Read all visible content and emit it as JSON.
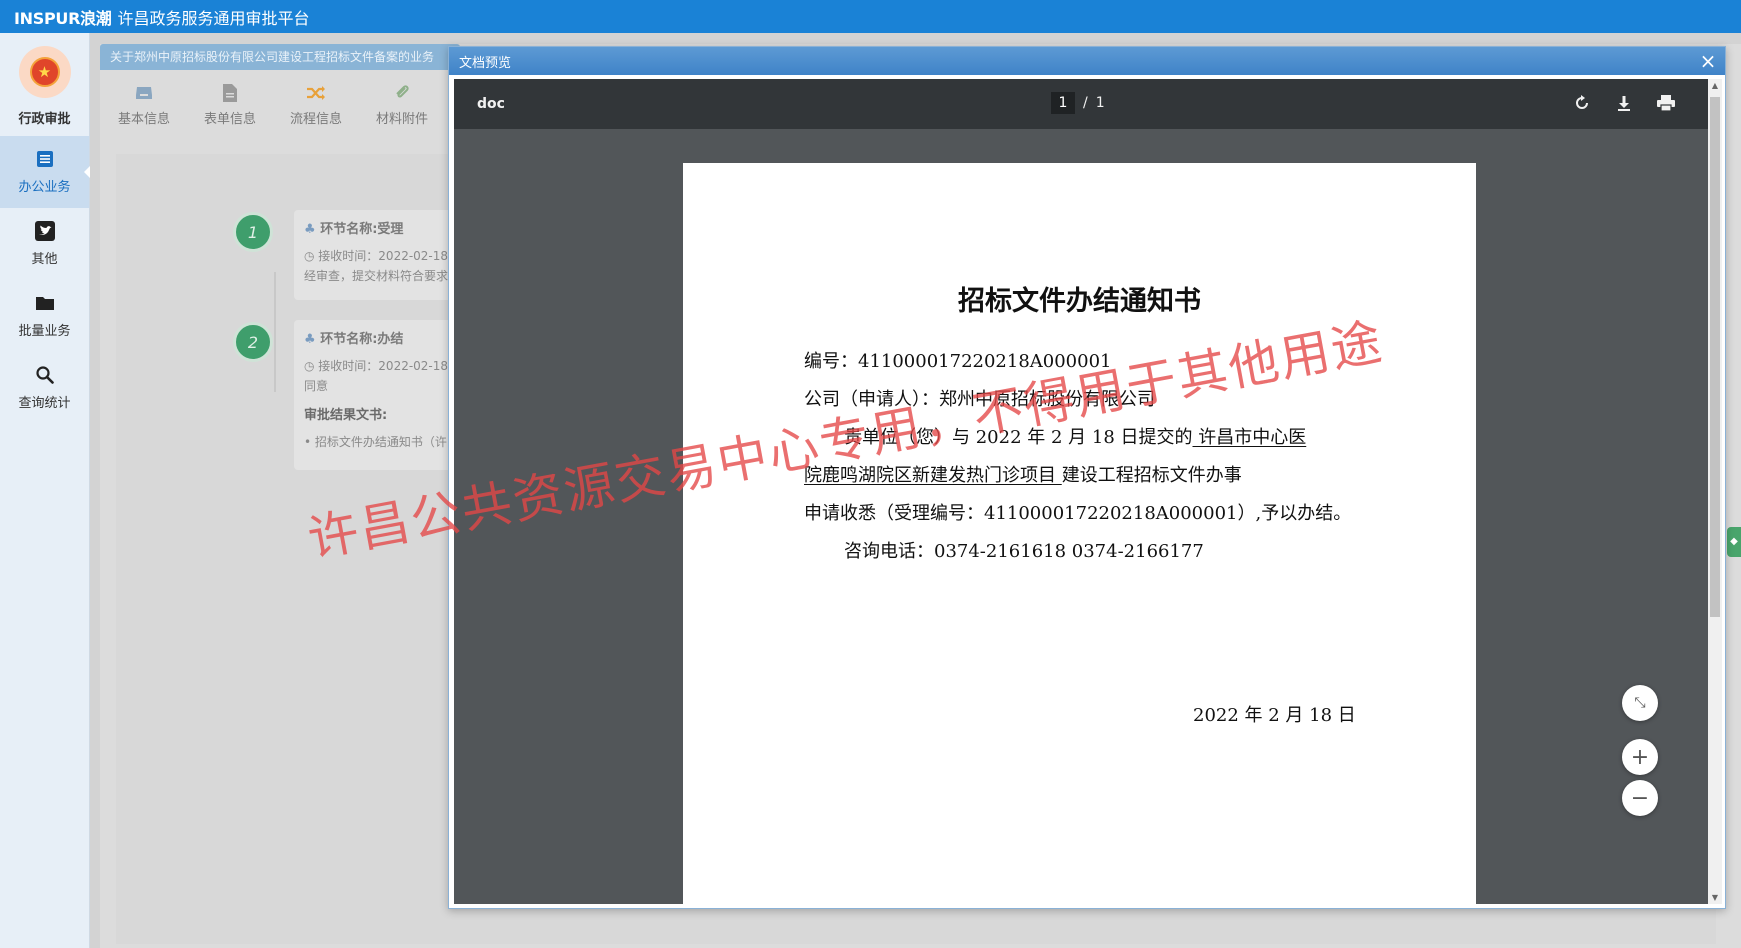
{
  "app": {
    "brand": "INSPUR浪潮",
    "title": "许昌政务服务通用审批平台"
  },
  "sidebar": {
    "logo_label": "行政审批",
    "items": [
      {
        "label": "办公业务",
        "icon": "list-icon",
        "active": true
      },
      {
        "label": "其他",
        "icon": "twitter-icon",
        "active": false
      },
      {
        "label": "批量业务",
        "icon": "folder-icon",
        "active": false
      },
      {
        "label": "查询统计",
        "icon": "search-icon",
        "active": false
      }
    ]
  },
  "workspace": {
    "tab_title": "关于郑州中原招标股份有限公司建设工程招标文件备案的业务",
    "toolbar": [
      {
        "label": "基本信息",
        "icon": "inbox-icon"
      },
      {
        "label": "表单信息",
        "icon": "document-icon"
      },
      {
        "label": "流程信息",
        "icon": "shuffle-icon"
      },
      {
        "label": "材料附件",
        "icon": "paperclip-icon"
      }
    ],
    "steps": [
      {
        "num": "1",
        "name": "环节名称:受理",
        "time": "接收时间：2022-02-18",
        "note": "经审查，提交材料符合要求"
      },
      {
        "num": "2",
        "name": "环节名称:办结",
        "time": "接收时间：2022-02-18",
        "note": "同意",
        "result_label": "审批结果文书:",
        "result_item": "招标文件办结通知书（许"
      }
    ]
  },
  "modal": {
    "title": "文档预览",
    "close": "×",
    "viewer": {
      "file_name": "doc",
      "page_current": "1",
      "page_sep": "/",
      "page_total": "1"
    }
  },
  "document": {
    "title": "招标文件办结通知书",
    "number_line": "编号：411000017220218A000001",
    "company_line": "公司（申请人）：郑州中原招标股份有限公司",
    "body_line1_a": "贵单位（您）与 2022 年 2 月 18 日提交的",
    "body_line1_b": "  许昌市中心医",
    "body_line2_a": "院鹿鸣湖院区新建发热门诊项目     ",
    "body_line2_b": "建设工程招标文件办事",
    "body_line3": "申请收悉（受理编号：411000017220218A000001）,予以办结。",
    "phone_line": "咨询电话：0374-2161618    0374-2166177",
    "date": "2022 年 2 月 18 日"
  },
  "watermark": "许昌公共资源交易中心专用，不得用于其他用途",
  "colors": {
    "topbar": "#1a82d6",
    "viewer_bg": "#525659",
    "viewer_bar": "#323639",
    "watermark": "#e44646",
    "step_green": "#3f9e6c"
  }
}
